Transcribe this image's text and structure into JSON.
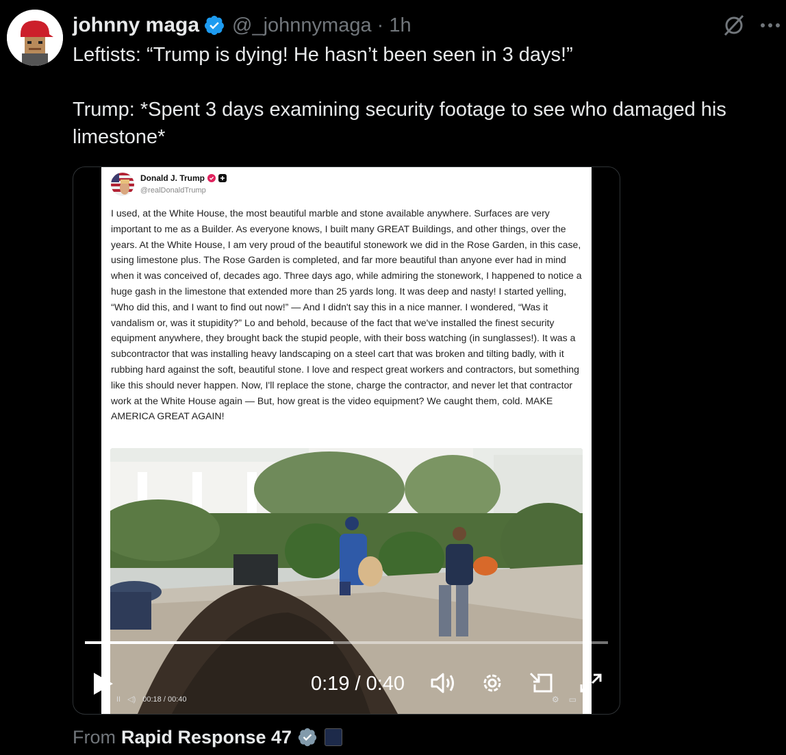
{
  "tweet": {
    "author_name": "johnny maga",
    "handle_time": "@_johnnymaga · 1h",
    "text": "Leftists: “Trump is dying! He hasn’t been seen in 3 days!”\n\nTrump: *Spent 3 days examining security footage to see who damaged his limestone*"
  },
  "embedded_post": {
    "author_name": "Donald J. Trump",
    "handle": "@realDonaldTrump",
    "body": "I used, at the White House, the most beautiful marble and stone available anywhere. Surfaces are very important to me as a Builder. As everyone knows, I built many GREAT Buildings, and other things, over the years. At the White House, I am very proud of the beautiful stonework we did in the Rose Garden, in this case, using limestone plus. The Rose Garden is completed, and far more beautiful than anyone ever had in mind when it was conceived of, decades ago. Three days ago, while admiring the stonework, I happened to notice a huge gash in the limestone that extended more than 25 yards long. It was deep and nasty! I started yelling, “Who did this, and I want to find out now!” — And I didn't say this in a nice manner. I wondered, “Was it vandalism or, was it stupidity?” Lo and behold, because of the fact that we've installed the finest security equipment anywhere, they brought back the stupid people, with their boss watching (in sunglasses!). It was a subcontractor that was installing heavy landscaping on a steel cart that was broken and tilting badly, with it rubbing hard against the soft, beautiful stone. I love and respect great workers and contractors, but something like this should never happen. Now, I'll replace the stone, charge the contractor, and never let that contractor work at the White House again — But, how great is the video equipment? We caught them, cold. MAKE AMERICA GREAT AGAIN!",
    "inner_time": "00:18 / 00:40"
  },
  "video": {
    "time": "0:19 / 0:40",
    "progress": 0.475
  },
  "source": {
    "prefix": "From",
    "name": "Rapid Response 47"
  },
  "colors": {
    "verified": "#1d9bf0",
    "background": "#000000",
    "muted_text": "#71767b"
  },
  "icons": [
    "verified-icon",
    "grok-icon",
    "more-icon",
    "play-icon",
    "volume-icon",
    "settings-icon",
    "pip-icon",
    "fullscreen-icon"
  ]
}
